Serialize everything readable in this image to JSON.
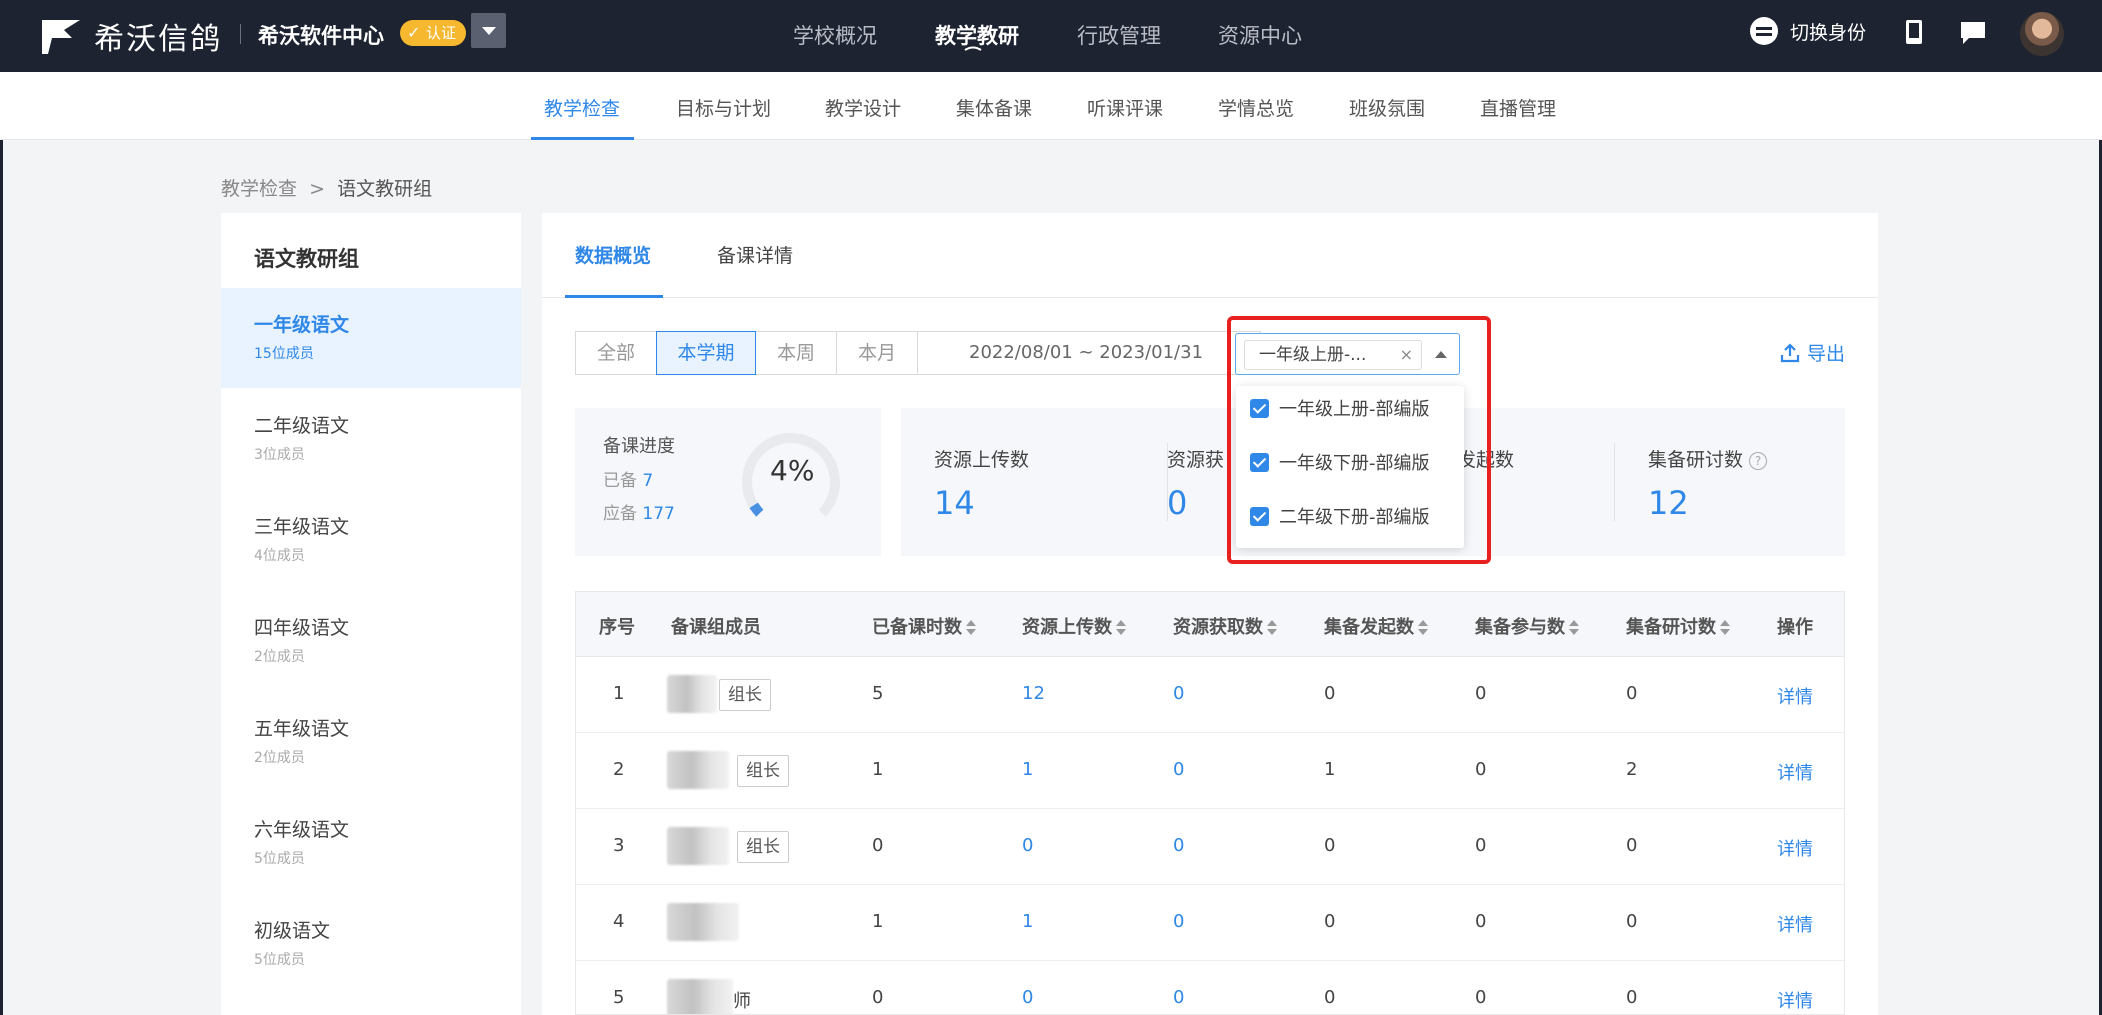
{
  "brand": {
    "logo_text": "希沃信鸽",
    "center_name": "希沃软件中心",
    "badge": "认证"
  },
  "main_nav": [
    {
      "label": "学校概况"
    },
    {
      "label": "教学教研"
    },
    {
      "label": "行政管理"
    },
    {
      "label": "资源中心"
    }
  ],
  "header_right": {
    "switch_identity": "切换身份"
  },
  "sub_nav": [
    {
      "label": "教学检查"
    },
    {
      "label": "目标与计划"
    },
    {
      "label": "教学设计"
    },
    {
      "label": "集体备课"
    },
    {
      "label": "听课评课"
    },
    {
      "label": "学情总览"
    },
    {
      "label": "班级氛围"
    },
    {
      "label": "直播管理"
    }
  ],
  "breadcrumb": {
    "root": "教学检查",
    "separator": ">",
    "current": "语文教研组"
  },
  "sidebar": {
    "title": "语文教研组",
    "items": [
      {
        "name": "一年级语文",
        "count": "15位成员"
      },
      {
        "name": "二年级语文",
        "count": "3位成员"
      },
      {
        "name": "三年级语文",
        "count": "4位成员"
      },
      {
        "name": "四年级语文",
        "count": "2位成员"
      },
      {
        "name": "五年级语文",
        "count": "2位成员"
      },
      {
        "name": "六年级语文",
        "count": "5位成员"
      },
      {
        "name": "初级语文",
        "count": "5位成员"
      }
    ]
  },
  "tabs": [
    {
      "label": "数据概览"
    },
    {
      "label": "备课详情"
    }
  ],
  "filters": {
    "periods": [
      {
        "label": "全部"
      },
      {
        "label": "本学期"
      },
      {
        "label": "本周"
      },
      {
        "label": "本月"
      }
    ],
    "date_range": "2022/08/01  ~  2023/01/31",
    "select_value": "一年级上册-...",
    "select_clear": "×",
    "export_label": "导出"
  },
  "dropdown": {
    "options": [
      {
        "label": "一年级上册-部编版",
        "checked": true
      },
      {
        "label": "一年级下册-部编版",
        "checked": true
      },
      {
        "label": "二年级下册-部编版",
        "checked": true
      }
    ]
  },
  "progress": {
    "label": "备课进度",
    "done_label": "已备",
    "done": "7",
    "required_label": "应备",
    "required": "177",
    "percent": "4%",
    "fraction": 0.04
  },
  "stats": [
    {
      "label": "资源上传数",
      "value": "14"
    },
    {
      "label": "资源获",
      "value": "0"
    },
    {
      "label": "发起数",
      "value": ""
    },
    {
      "label": "集备研讨数",
      "value": "12"
    }
  ],
  "table": {
    "headers": [
      "序号",
      "备课组成员",
      "已备课时数",
      "资源上传数",
      "资源获取数",
      "集备发起数",
      "集备参与数",
      "集备研讨数",
      "操作"
    ],
    "rows": [
      {
        "index": "1",
        "suffix": "",
        "tag": "组长",
        "lessons": "5",
        "uploads": "12",
        "gets": "0",
        "initiated": "0",
        "joined": "0",
        "discussions": "0",
        "action": "详情"
      },
      {
        "index": "2",
        "suffix": "",
        "tag": "组长",
        "lessons": "1",
        "uploads": "1",
        "gets": "0",
        "initiated": "1",
        "joined": "0",
        "discussions": "2",
        "action": "详情"
      },
      {
        "index": "3",
        "suffix": "",
        "tag": "组长",
        "lessons": "0",
        "uploads": "0",
        "gets": "0",
        "initiated": "0",
        "joined": "0",
        "discussions": "0",
        "action": "详情"
      },
      {
        "index": "4",
        "suffix": "",
        "tag": "",
        "lessons": "1",
        "uploads": "1",
        "gets": "0",
        "initiated": "0",
        "joined": "0",
        "discussions": "0",
        "action": "详情"
      },
      {
        "index": "5",
        "suffix": "师",
        "tag": "",
        "lessons": "0",
        "uploads": "0",
        "gets": "0",
        "initiated": "0",
        "joined": "0",
        "discussions": "0",
        "action": "详情"
      }
    ]
  },
  "colors": {
    "header_bg": "#1e2331",
    "accent": "#2f88e8",
    "badge": "#f5b82e",
    "highlight": "#e82020"
  }
}
